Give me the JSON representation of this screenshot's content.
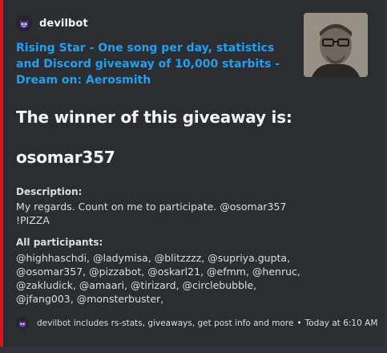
{
  "embed": {
    "accent_color": "#e3121a",
    "background": "#2b2d31",
    "author": {
      "name": "devilbot",
      "icon": "devilbot-avatar-icon"
    },
    "title": "Rising Star - One song per day, statistics and Discord giveaway of 10,000 starbits - Dream on: Aerosmith",
    "title_color": "#1da1f2",
    "thumbnail": "author-photo",
    "headings": {
      "winner_line": "The winner of this giveaway is:",
      "winner_name": "osomar357"
    },
    "fields": {
      "description": {
        "name": "Description:",
        "lines": [
          "My regards. Count on me to participate. @osomar357",
          "!PIZZA"
        ]
      },
      "participants": {
        "name": "All participants:",
        "lines": [
          "@highhaschdi, @ladymisa, @blitzzzz, @supriya.gupta,",
          "@osomar357, @pizzabot, @oskarl21, @efmm, @henruc,",
          "@zakludick, @amaari, @tirizard, @circlebubble,",
          "@jfang003, @monsterbuster,"
        ]
      }
    },
    "footer": {
      "icon": "devilbot-avatar-icon",
      "text": "devilbot includes rs-stats, giveaways, get post info and more",
      "separator": "•",
      "timestamp": "Today at 6:10 AM"
    }
  }
}
